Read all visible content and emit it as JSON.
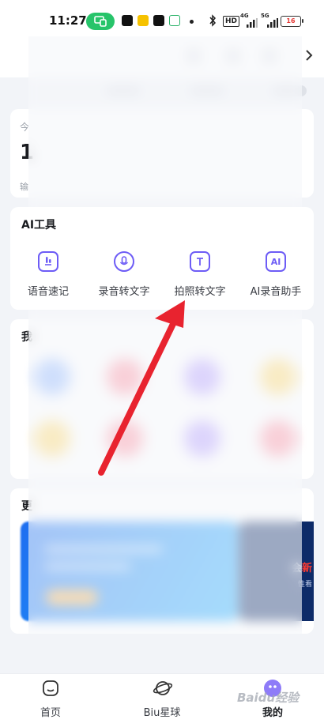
{
  "status_bar": {
    "time": "11:27",
    "icons": [
      "screen-cast-icon",
      "app-notification-icon",
      "app-notification-icon",
      "app-notification-icon",
      "app-notification-icon",
      "bluetooth-icon",
      "hd-icon",
      "signal-icon",
      "signal-icon"
    ],
    "hd_label": "HD",
    "net1_label": "4G",
    "net2_label": "5G",
    "battery": "16"
  },
  "stats": {
    "label": "今",
    "value": "1",
    "sub": "输"
  },
  "ai_tools": {
    "title": "AI工具",
    "items": [
      {
        "label": "语音速记",
        "icon": "mic-icon"
      },
      {
        "label": "录音转文字",
        "icon": "record-icon"
      },
      {
        "label": "拍照转文字",
        "icon": "photo-text-icon"
      },
      {
        "label": "AI录音助手",
        "icon": "ai-icon",
        "glyph": "AI"
      }
    ]
  },
  "my_section": {
    "title": "我"
  },
  "more_section": {
    "title": "更",
    "banner2_line1": "会",
    "banner2_line1_highlight": "新",
    "banner2_line2": "性看"
  },
  "bottom_nav": {
    "items": [
      {
        "label": "首页",
        "icon": "home-icon",
        "active": false
      },
      {
        "label": "Biu星球",
        "icon": "planet-icon",
        "active": false
      },
      {
        "label": "我的",
        "icon": "profile-icon",
        "active": true
      }
    ]
  },
  "watermark": "Baidu经验",
  "colors": {
    "accent": "#6d5cf6",
    "arrow": "#e8232f",
    "cast_pill": "#27c46a",
    "banner_blue": "#1e6ef0",
    "banner_dark": "#0d2b68"
  }
}
